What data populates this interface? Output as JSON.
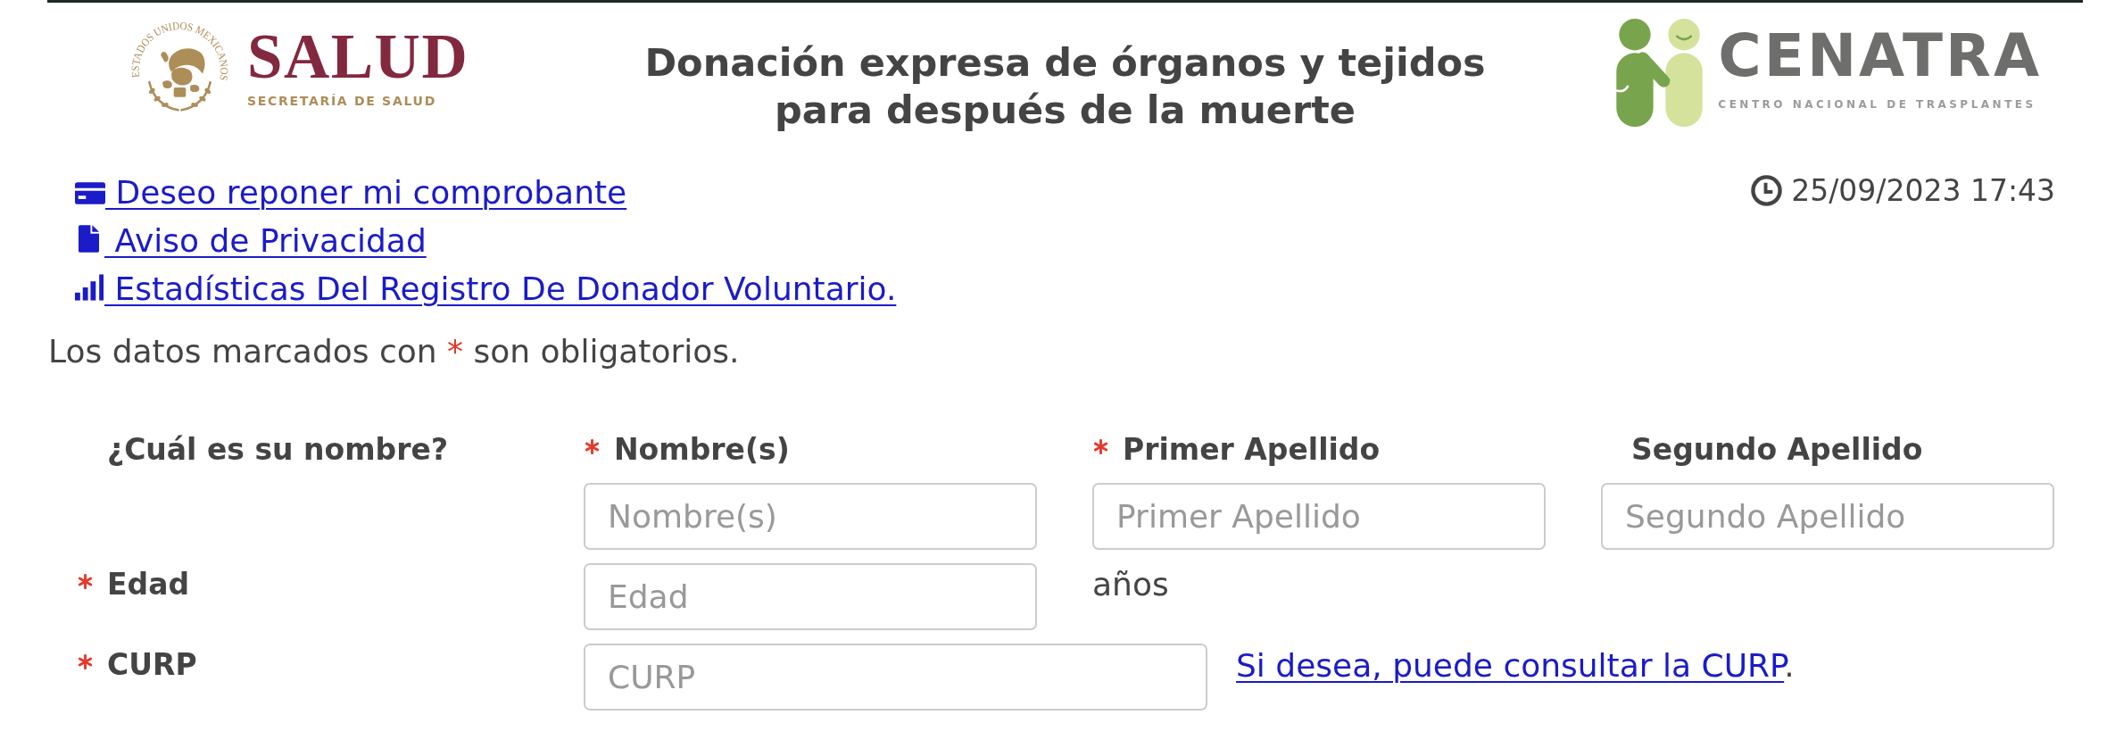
{
  "header": {
    "left_logo": {
      "seal_text": "ESTADOS UNIDOS MEXICANOS",
      "name": "SALUD",
      "tagline": "SECRETARÍA DE SALUD"
    },
    "title_lines": [
      "Donación expresa de órganos y tejidos",
      "para después de la muerte"
    ],
    "right_logo": {
      "name": "CENATRA",
      "tagline": "CENTRO NACIONAL DE TRASPLANTES"
    }
  },
  "links": [
    {
      "kind": "card",
      "label": "Deseo reponer mi comprobante"
    },
    {
      "kind": "document",
      "label": "Aviso de Privacidad"
    },
    {
      "kind": "bars",
      "label": "Estadísticas Del Registro De Donador Voluntario."
    }
  ],
  "timestamp": "25/09/2023 17:43",
  "required_note": {
    "before": "Los datos marcados con",
    "mark": "*",
    "after": "son obligatorios."
  },
  "form": {
    "name_question": "¿Cuál es su nombre?",
    "name_fields": [
      {
        "label": "Nombre(s)",
        "required": true,
        "placeholder": "Nombre(s)"
      },
      {
        "label": "Primer Apellido",
        "required": true,
        "placeholder": "Primer Apellido"
      },
      {
        "label": "Segundo Apellido",
        "required": false,
        "placeholder": "Segundo Apellido"
      }
    ],
    "age": {
      "label": "Edad",
      "required": true,
      "placeholder": "Edad",
      "unit": "años"
    },
    "curp": {
      "label": "CURP",
      "required": true,
      "placeholder": "CURP",
      "hint_link": "Si desea, puede consultar la CURP",
      "hint_suffix": "."
    }
  }
}
